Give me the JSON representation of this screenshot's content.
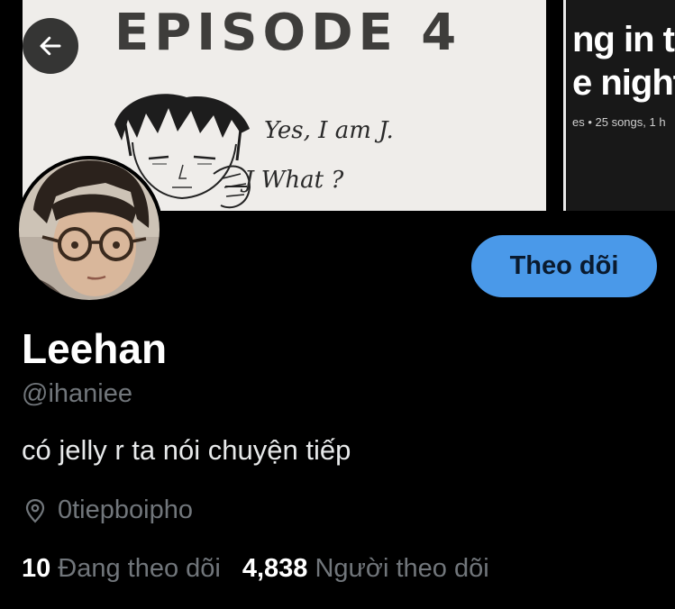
{
  "banner": {
    "episode_title": "EPISODE 4",
    "speech_line1": "Yes, I am J.",
    "speech_line2": "J What ?",
    "playlist_title_line1": "ng in t",
    "playlist_title_line2": "e night",
    "playlist_meta": "es • 25 songs, 1 h"
  },
  "profile": {
    "follow_button_label": "Theo dõi",
    "display_name": "Leehan",
    "handle": "@ihaniee",
    "bio": "có jelly r ta nói chuyện tiếp",
    "location": "0tiepboipho",
    "following_count": "10",
    "following_label": "Đang theo dõi",
    "followers_count": "4,838",
    "followers_label": "Người theo dõi"
  },
  "colors": {
    "background": "#000000",
    "accent_button": "#4a99e9",
    "secondary_text": "#71767b",
    "primary_text": "#e7e9ea"
  },
  "icons": {
    "back": "arrow-left-icon",
    "location": "location-pin-icon"
  }
}
